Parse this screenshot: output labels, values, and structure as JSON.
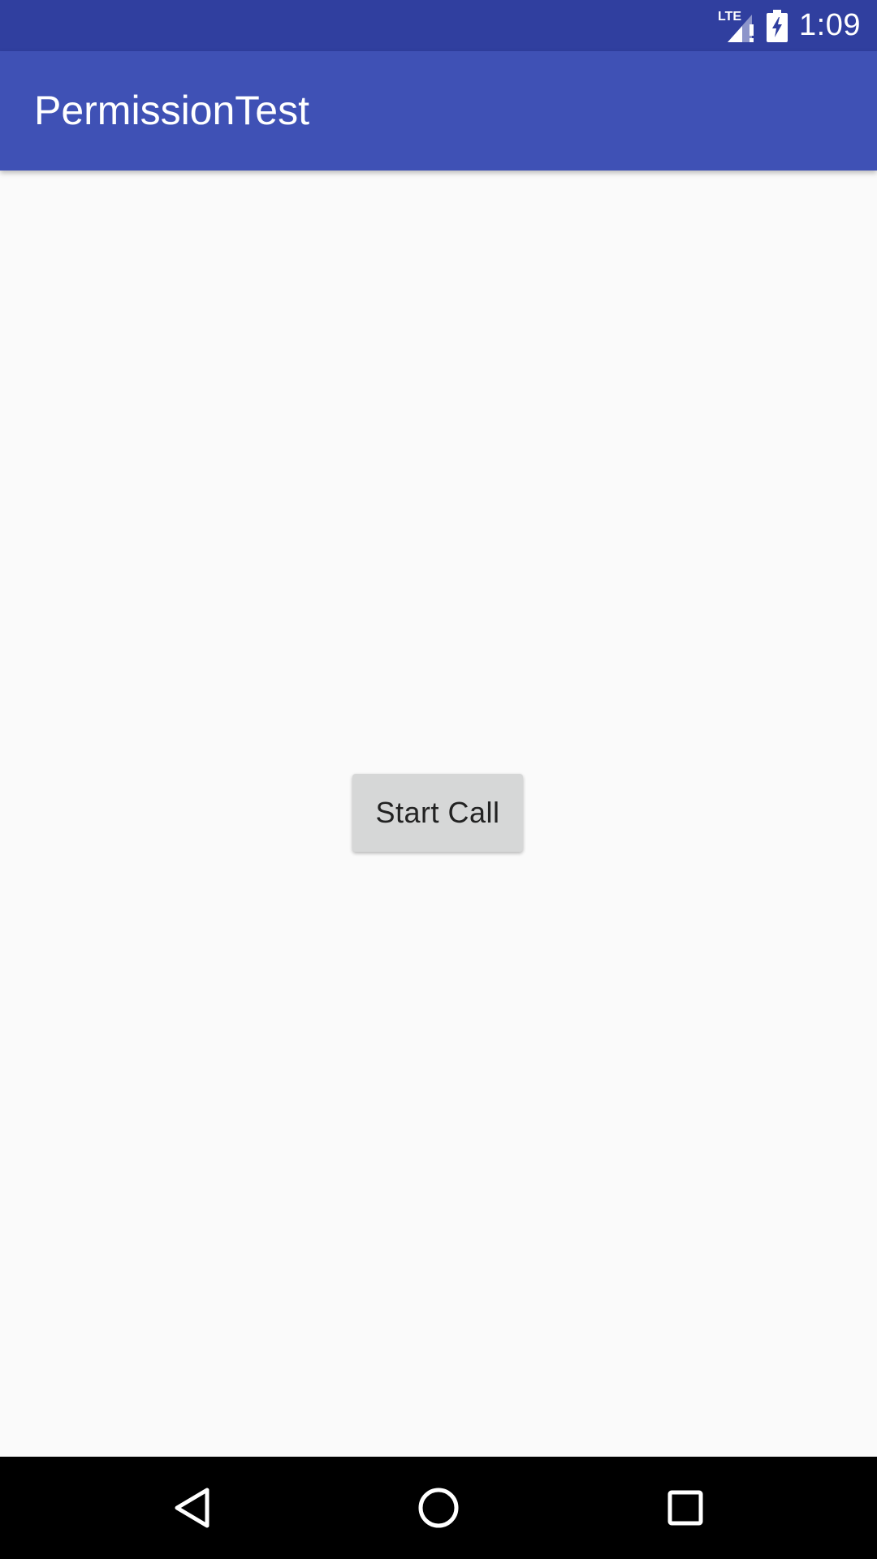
{
  "status_bar": {
    "network_label": "LTE",
    "network_icon": "signal-alert-icon",
    "battery_icon": "battery-charging-icon",
    "time": "1:09"
  },
  "app_bar": {
    "title": "PermissionTest"
  },
  "main": {
    "start_call_label": "Start Call"
  },
  "nav_bar": {
    "back_icon": "back-icon",
    "home_icon": "home-icon",
    "recents_icon": "recents-icon"
  },
  "colors": {
    "status_bar": "#303f9f",
    "app_bar": "#3f51b5",
    "background": "#fafafa",
    "button": "#d6d7d7",
    "nav_bar": "#000000"
  }
}
